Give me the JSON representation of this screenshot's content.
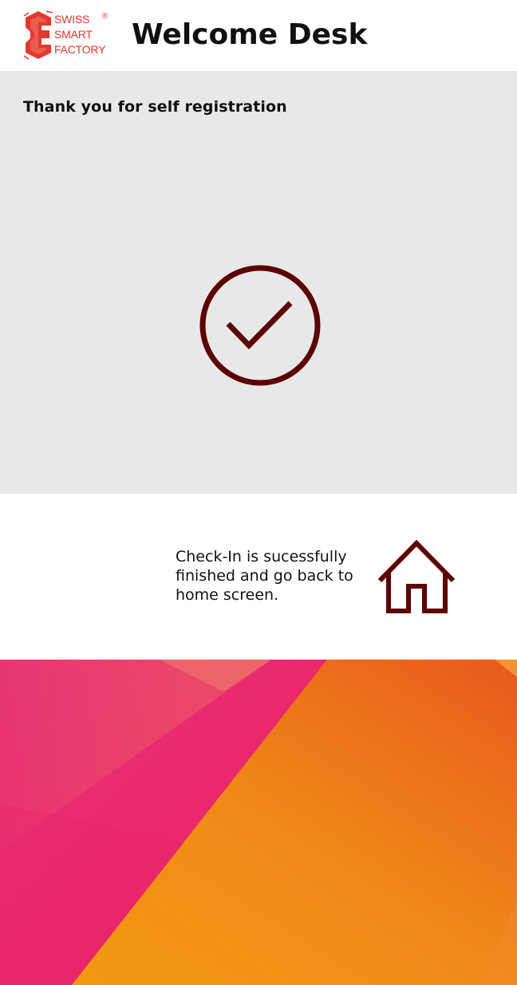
{
  "header": {
    "logo": {
      "line1": "SWISS",
      "line2": "SMART",
      "line3": "FACTORY",
      "registered": "®",
      "color": "#e03a2f"
    },
    "title": "Welcome Desk"
  },
  "panel": {
    "message": "Thank you for self registration",
    "icon": "check-circle-icon",
    "icon_color": "#5c0000"
  },
  "footer": {
    "message": "Check-In is sucessfully finished and go back to home screen.",
    "home_icon": "home-icon",
    "icon_color": "#5c0000"
  },
  "colors": {
    "panel_bg": "#e8e8e8",
    "accent_pink": "#e91e63",
    "accent_orange": "#f39c12"
  }
}
